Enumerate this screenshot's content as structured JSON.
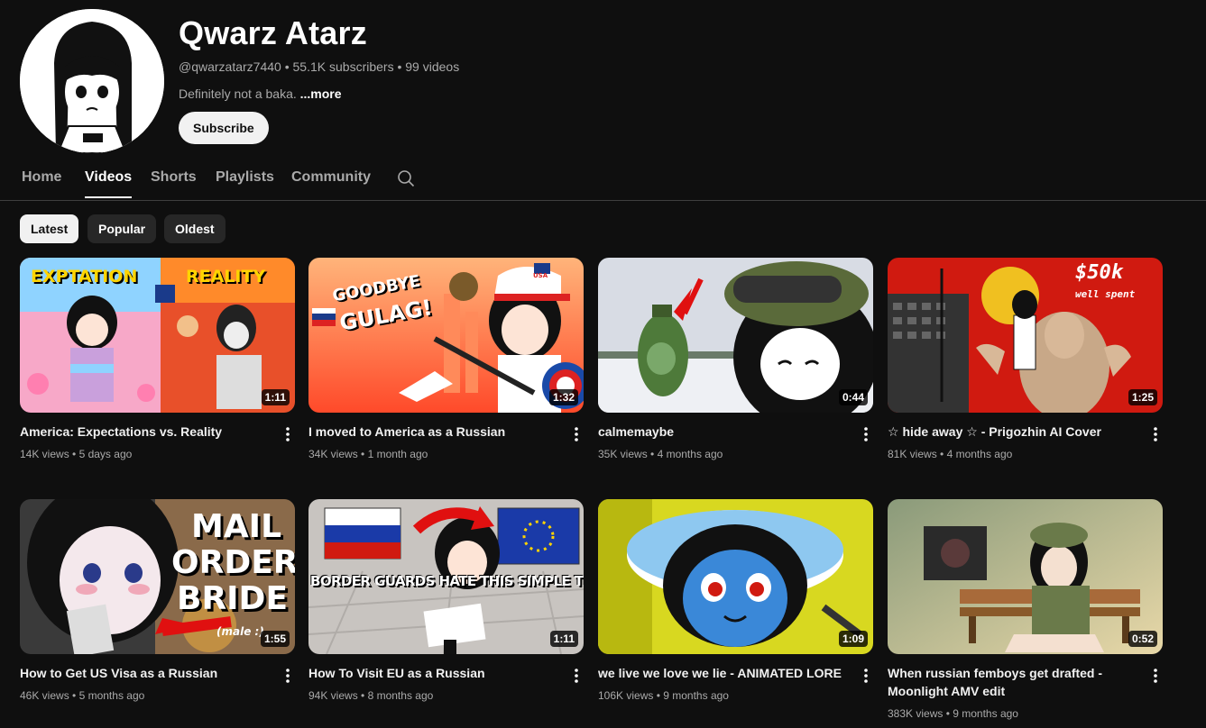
{
  "channel": {
    "name": "Qwarz Atarz",
    "handle": "@qwarzatarz7440",
    "subscribers": "55.1K subscribers",
    "videos_count": "99 videos",
    "description": "Definitely not a baka.",
    "more": "...more",
    "subscribe_label": "Subscribe"
  },
  "tabs": [
    "Home",
    "Videos",
    "Shorts",
    "Playlists",
    "Community"
  ],
  "filters": [
    "Latest",
    "Popular",
    "Oldest"
  ],
  "videos": [
    {
      "title": "America: Expectations vs. Reality",
      "title2": "",
      "views": "14K views",
      "age": "5 days ago",
      "duration": "1:11"
    },
    {
      "title": "I moved to America as a Russian",
      "title2": "",
      "views": "34K views",
      "age": "1 month ago",
      "duration": "1:32"
    },
    {
      "title": "calmemaybe",
      "title2": "",
      "views": "35K views",
      "age": "4 months ago",
      "duration": "0:44"
    },
    {
      "title": "☆ hide away ☆ - Prigozhin AI Cover",
      "title2": "",
      "views": "81K views",
      "age": "4 months ago",
      "duration": "1:25"
    },
    {
      "title": "How to Get US Visa as a Russian",
      "title2": "",
      "views": "46K views",
      "age": "5 months ago",
      "duration": "1:55"
    },
    {
      "title": "How To Visit EU as a Russian",
      "title2": "",
      "views": "94K views",
      "age": "8 months ago",
      "duration": "1:11"
    },
    {
      "title": "we live we love we lie - ANIMATED LORE",
      "title2": "",
      "views": "106K views",
      "age": "9 months ago",
      "duration": "1:09"
    },
    {
      "title": "When russian femboys get drafted -",
      "title2": "Moonlight AMV edit",
      "views": "383K views",
      "age": "9 months ago",
      "duration": "0:52"
    }
  ],
  "thumb_text": {
    "v1_left": "EXPTATION",
    "v1_right": "REALITY",
    "v2_a": "GOODBYE",
    "v2_b": "GULAG!",
    "v2_hat": "USA",
    "v4_price": "$50k",
    "v4_sub": "well spent",
    "v5_a": "MAIL",
    "v5_b": "ORDER",
    "v5_c": "BRIDE",
    "v5_d": "(male :)",
    "v6_banner": "BORDER GUARDS HATE THIS SIMPLE TRICK"
  },
  "colors": {
    "background": "#0f0f0f",
    "text_primary": "#f1f1f1",
    "text_secondary": "#aaaaaa",
    "chip_bg": "#272727"
  }
}
